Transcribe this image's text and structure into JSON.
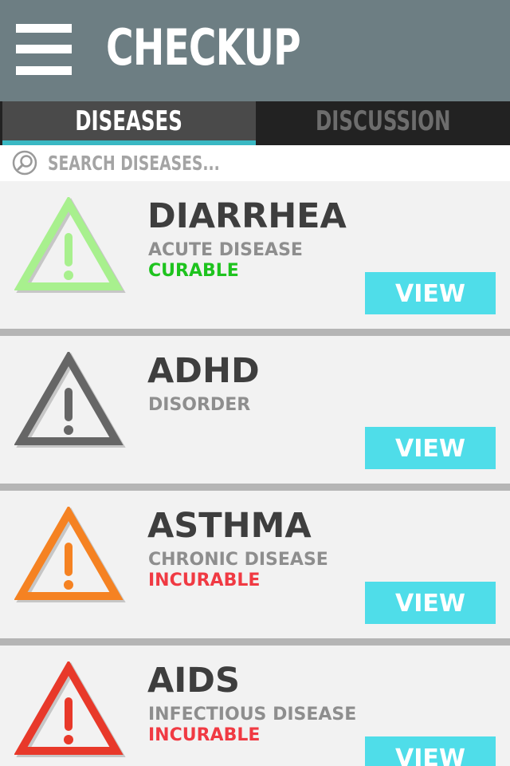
{
  "header": {
    "title": "CHECKUP",
    "menu_icon": "hamburger-menu-icon"
  },
  "tabs": [
    {
      "label": "DISEASES",
      "active": true
    },
    {
      "label": "DISCUSSION",
      "active": false
    }
  ],
  "search": {
    "placeholder": "SEARCH DISEASES...",
    "icon": "search-icon"
  },
  "colors": {
    "header_bg": "#6d7e83",
    "accent": "#3ab8c3",
    "button_bg": "#4fdde9",
    "curable": "#1ec31e",
    "incurable": "#f03a43"
  },
  "diseases": [
    {
      "name": "DIARRHEA",
      "type": "ACUTE DISEASE",
      "status": "CURABLE",
      "status_color": "#1ec31e",
      "icon": "warning-triangle-icon",
      "icon_color": "#a8f08e",
      "view_label": "VIEW"
    },
    {
      "name": "ADHD",
      "type": "DISORDER",
      "status": "",
      "status_color": "",
      "icon": "warning-triangle-icon",
      "icon_color": "#666666",
      "view_label": "VIEW"
    },
    {
      "name": "ASTHMA",
      "type": "CHRONIC DISEASE",
      "status": "INCURABLE",
      "status_color": "#f03a43",
      "icon": "warning-triangle-icon",
      "icon_color": "#f58222",
      "view_label": "VIEW"
    },
    {
      "name": "AIDS",
      "type": "INFECTIOUS DISEASE",
      "status": "INCURABLE",
      "status_color": "#f03a43",
      "icon": "warning-triangle-icon",
      "icon_color": "#e8392a",
      "view_label": "VIEW"
    }
  ]
}
